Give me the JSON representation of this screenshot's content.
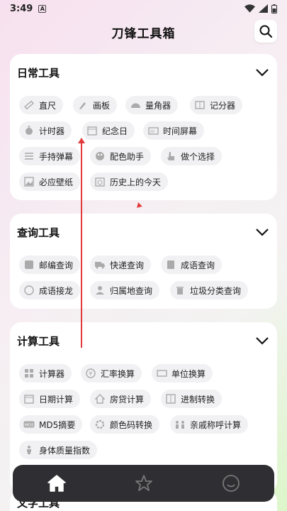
{
  "status": {
    "time": "3:49",
    "notif_icon": "A"
  },
  "header": {
    "title": "刀锋工具箱"
  },
  "sections": [
    {
      "title": "日常工具",
      "items": [
        "直尺",
        "画板",
        "量角器",
        "记分器",
        "计时器",
        "纪念日",
        "时间屏幕",
        "手持弹幕",
        "配色助手",
        "做个选择",
        "必应壁纸",
        "历史上的今天"
      ]
    },
    {
      "title": "查询工具",
      "items": [
        "邮编查询",
        "快递查询",
        "成语查询",
        "成语接龙",
        "归属地查询",
        "垃圾分类查询"
      ]
    },
    {
      "title": "计算工具",
      "items": [
        "计算器",
        "汇率换算",
        "单位换算",
        "日期计算",
        "房贷计算",
        "进制转换",
        "MD5摘要",
        "颜色码转换",
        "亲戚称呼计算",
        "身体质量指数"
      ]
    },
    {
      "title": "文字工具"
    }
  ],
  "tabbar": {
    "tabs": [
      "home-icon",
      "star-icon",
      "smile-icon"
    ]
  },
  "colors": {
    "accent": "#e23a3a",
    "tabbar": "#2f2f33"
  }
}
